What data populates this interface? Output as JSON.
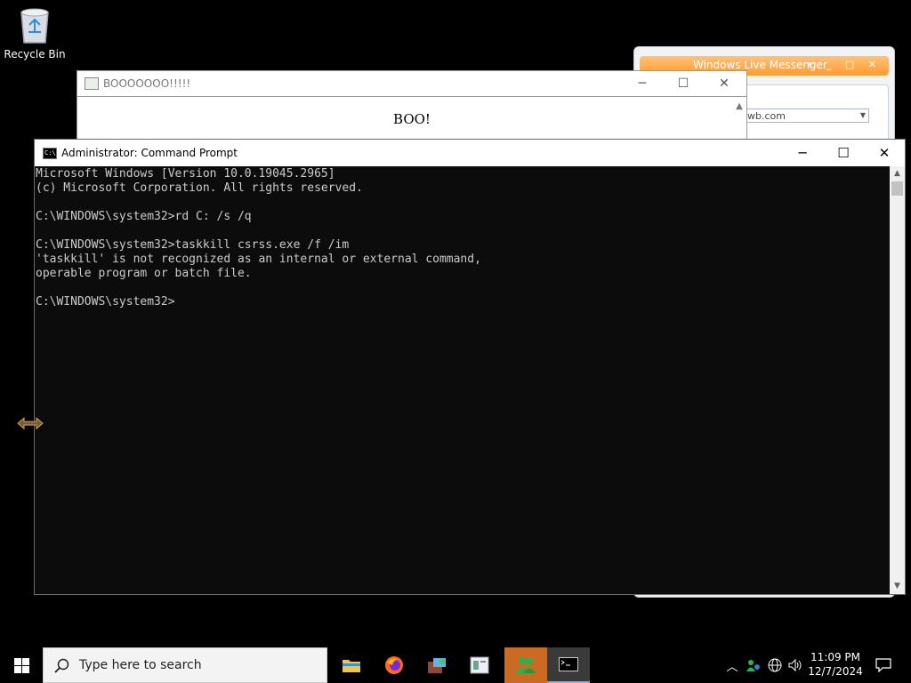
{
  "desktop": {
    "recycle_bin_label": "Recycle Bin"
  },
  "messenger": {
    "title": "Windows Live Messenger",
    "controls": "▾ _ □ ✕",
    "input_value": "wb.com"
  },
  "boo_window": {
    "title": "BOOOOOOO!!!!!",
    "body_text": "BOO!"
  },
  "cmd": {
    "title": "Administrator: Command Prompt",
    "lines": [
      "Microsoft Windows [Version 10.0.19045.2965]",
      "(c) Microsoft Corporation. All rights reserved.",
      "",
      "C:\\WINDOWS\\system32>rd C: /s /q",
      "",
      "C:\\WINDOWS\\system32>taskkill csrss.exe /f /im",
      "'taskkill' is not recognized as an internal or external command,",
      "operable program or batch file.",
      "",
      "C:\\WINDOWS\\system32>"
    ]
  },
  "taskbar": {
    "search_placeholder": "Type here to search",
    "apps": [
      "file-explorer",
      "firefox",
      "package-app",
      "notepad-app",
      "windows-live-messenger",
      "command-prompt"
    ],
    "time": "11:09 PM",
    "date": "12/7/2024"
  }
}
